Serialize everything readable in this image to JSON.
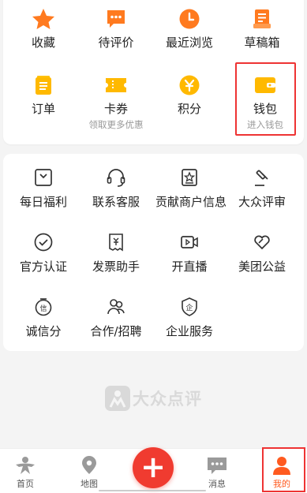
{
  "colors": {
    "accent": "#ff5a1f",
    "icon_orange": "#ff6f1a",
    "highlight": "#e33333",
    "fab": "#f03b30"
  },
  "top_grid": [
    {
      "label": "收藏",
      "icon": "star-icon"
    },
    {
      "label": "待评价",
      "icon": "comment-icon"
    },
    {
      "label": "最近浏览",
      "icon": "clock-icon"
    },
    {
      "label": "草稿箱",
      "icon": "draft-icon"
    },
    {
      "label": "订单",
      "icon": "order-icon"
    },
    {
      "label": "卡券",
      "icon": "ticket-icon",
      "sub": "领取更多优惠"
    },
    {
      "label": "积分",
      "icon": "points-icon"
    },
    {
      "label": "钱包",
      "icon": "wallet-icon",
      "sub": "进入钱包"
    }
  ],
  "services": [
    {
      "label": "每日福利",
      "icon": "gift-box-icon"
    },
    {
      "label": "联系客服",
      "icon": "headset-icon"
    },
    {
      "label": "贡献商户信息",
      "icon": "shop-star-icon"
    },
    {
      "label": "大众评审",
      "icon": "gavel-icon"
    },
    {
      "label": "官方认证",
      "icon": "check-circle-icon"
    },
    {
      "label": "发票助手",
      "icon": "invoice-icon"
    },
    {
      "label": "开直播",
      "icon": "live-icon"
    },
    {
      "label": "美团公益",
      "icon": "heart-hands-icon"
    },
    {
      "label": "诚信分",
      "icon": "credit-badge-icon"
    },
    {
      "label": "合作/招聘",
      "icon": "people-icon"
    },
    {
      "label": "企业服务",
      "icon": "enterprise-icon"
    }
  ],
  "watermark": {
    "logo": "大众点评"
  },
  "tabbar": [
    {
      "label": "首页",
      "icon": "home-icon"
    },
    {
      "label": "地图",
      "icon": "map-pin-icon"
    },
    {
      "label": "消息",
      "icon": "message-icon"
    },
    {
      "label": "我的",
      "icon": "profile-icon",
      "active": true
    }
  ],
  "fab": {
    "label": "+"
  }
}
